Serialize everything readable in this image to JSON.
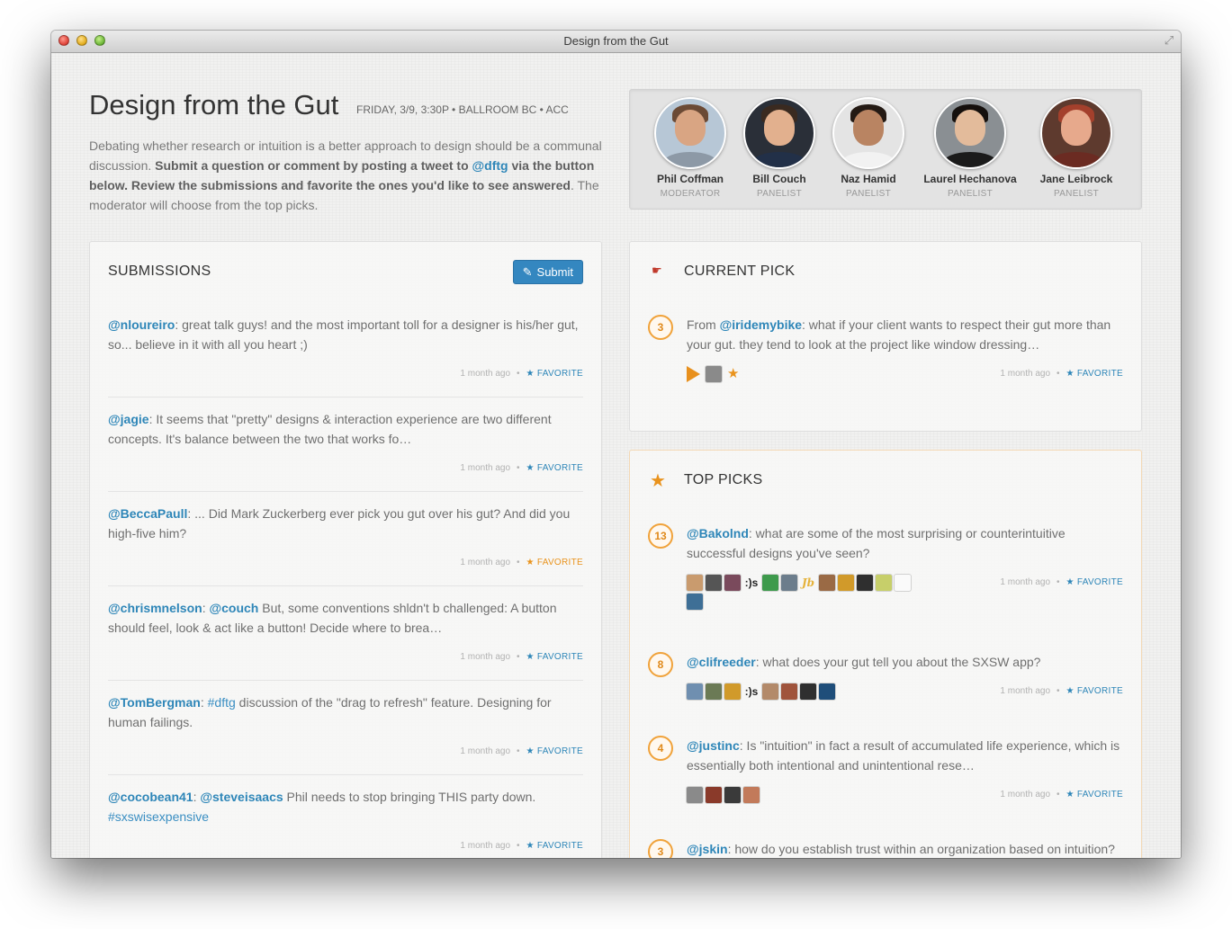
{
  "window": {
    "title": "Design from the Gut"
  },
  "header": {
    "title": "Design from the Gut",
    "meta": "FRIDAY, 3/9, 3:30P • BALLROOM BC • ACC",
    "intro_1": "Debating whether research or intuition is a better approach to design should be a communal discussion.",
    "intro_bold_1": "Submit a question or comment by posting a tweet to",
    "intro_handle": "@dftg",
    "intro_bold_2": "via the button below. Review the submissions and favorite the ones you'd like to see answered",
    "intro_2": ". The moderator will choose from the top picks."
  },
  "panel": [
    {
      "name": "Phil Coffman",
      "role": "MODERATOR",
      "bg": "#b7c7d6",
      "skin": "#d9a583",
      "hair": "#6b4a35",
      "shirt": "#8d99a6"
    },
    {
      "name": "Bill Couch",
      "role": "PANELIST",
      "bg": "#2a2f38",
      "skin": "#e2b08e",
      "hair": "#3a2a20",
      "shirt": "#223048"
    },
    {
      "name": "Naz Hamid",
      "role": "PANELIST",
      "bg": "#e4e4e4",
      "skin": "#b98462",
      "hair": "#241a14",
      "shirt": "#f2f2f2"
    },
    {
      "name": "Laurel Hechanova",
      "role": "PANELIST",
      "bg": "#8a8f93",
      "skin": "#e3bb9b",
      "hair": "#15100d",
      "shirt": "#1b1b1b"
    },
    {
      "name": "Jane Leibrock",
      "role": "PANELIST",
      "bg": "#5e3a2e",
      "skin": "#e7a98c",
      "hair": "#a4402c",
      "shirt": "#6b2b22"
    }
  ],
  "submissions": {
    "title": "SUBMISSIONS",
    "submit_label": "Submit",
    "time_label": "1 month ago",
    "fav_label": "FAVORITE",
    "items": [
      {
        "user": "@nloureiro",
        "text": ": great talk guys! and the most important toll for a designer is his/her gut, so... believe in it with all you heart ;)",
        "favorited": false
      },
      {
        "user": "@jagie",
        "text": ": It seems that \"pretty\" designs & interaction experience are two different concepts. It's balance between the two that works fo…",
        "favorited": false
      },
      {
        "user": "@BeccaPaull",
        "text": ": ... Did Mark Zuckerberg ever pick you gut over his gut? And did you high-five him?",
        "favorited": true
      },
      {
        "user": "@chrismnelson",
        "text": ": ",
        "mention": "@couch",
        "text2": " But, some conventions shldn't b challenged: A button should feel, look & act like a button! Decide where to brea…",
        "favorited": false
      },
      {
        "user": "@TomBergman",
        "text": ": ",
        "tag": "#dftg",
        "text2": " discussion of the \"drag to refresh\" feature. Designing for human failings.",
        "favorited": false
      },
      {
        "user": "@cocobean41",
        "text": ": ",
        "mention": "@steveisaacs",
        "text2": " Phil needs to stop bringing THIS party down.",
        "tag2": "#sxswisexpensive",
        "favorited": false
      }
    ]
  },
  "current_pick": {
    "title": "CURRENT PICK",
    "count": "3",
    "prefix": "From ",
    "user": "@iridemybike",
    "text": ": what if your client wants to respect their gut more than your gut. they tend to look at the project like window dressing…",
    "time": "1 month ago",
    "fav": "FAVORITE"
  },
  "top_picks": {
    "title": "TOP PICKS",
    "time_label": "1 month ago",
    "fav_label": "FAVORITE",
    "items": [
      {
        "count": "13",
        "user": "@Bakolnd",
        "text": ": what are some of the most surprising or counterintuitive successful designs you've seen?"
      },
      {
        "count": "8",
        "user": "@clifreeder",
        "text": ": what does your gut tell you about the SXSW app?"
      },
      {
        "count": "4",
        "user": "@justinc",
        "text": ": Is \"intuition\" in fact a result of accumulated life experience, which is essentially both intentional and unintentional rese…"
      },
      {
        "count": "3",
        "user": "@jskin",
        "text": ": how do you establish trust within an organization based on intuition?"
      }
    ],
    "face_text": ":)s",
    "face_script": "Jb"
  },
  "colors": {
    "link": "#2e86b8",
    "accent": "#e9931d",
    "button": "#3487c0"
  }
}
